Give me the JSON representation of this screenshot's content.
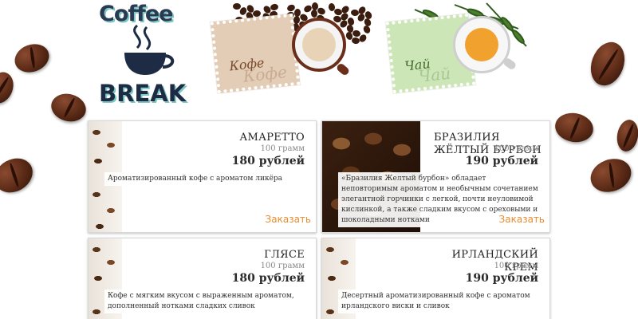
{
  "logo": {
    "line1": "Coffee",
    "line2": "BREAK"
  },
  "categories": [
    {
      "label": "Кофе",
      "ghost": "Кофе"
    },
    {
      "label": "Чай",
      "ghost": "Чай"
    }
  ],
  "products": [
    {
      "name": "АМАРЕТТО",
      "weight": "100 грамм",
      "price": "180 рублей",
      "description": "Ароматизированный кофе с ароматом ликёра",
      "order_label": "Заказать"
    },
    {
      "name": "БРАЗИЛИЯ ЖЁЛТЫЙ БУРБОН",
      "weight": "100 грамм",
      "price": "190 рублей",
      "description": "«Бразилия Желтый бурбон» обладает неповторимым ароматом и необычным сочетанием элегантной горчинки с легкой, почти неуловимой кислинкой, а также сладким вкусом с ореховыми и шоколадными нотками",
      "order_label": "Заказать"
    },
    {
      "name": "ГЛЯСЕ",
      "weight": "100 грамм",
      "price": "180 рублей",
      "description": "Кофе с мягким вкусом с выраженным ароматом, дополненный нотками сладких сливок"
    },
    {
      "name": "ИРЛАНДСКИЙ КРЕМ",
      "weight": "100 грамм",
      "price": "190 рублей",
      "description": "Десертный ароматизированный кофе с ароматом ирландского виски и сливок"
    }
  ],
  "colors": {
    "accent": "#e98b2f",
    "logo_dark": "#1d2c44",
    "logo_teal": "#7fc7c2"
  }
}
